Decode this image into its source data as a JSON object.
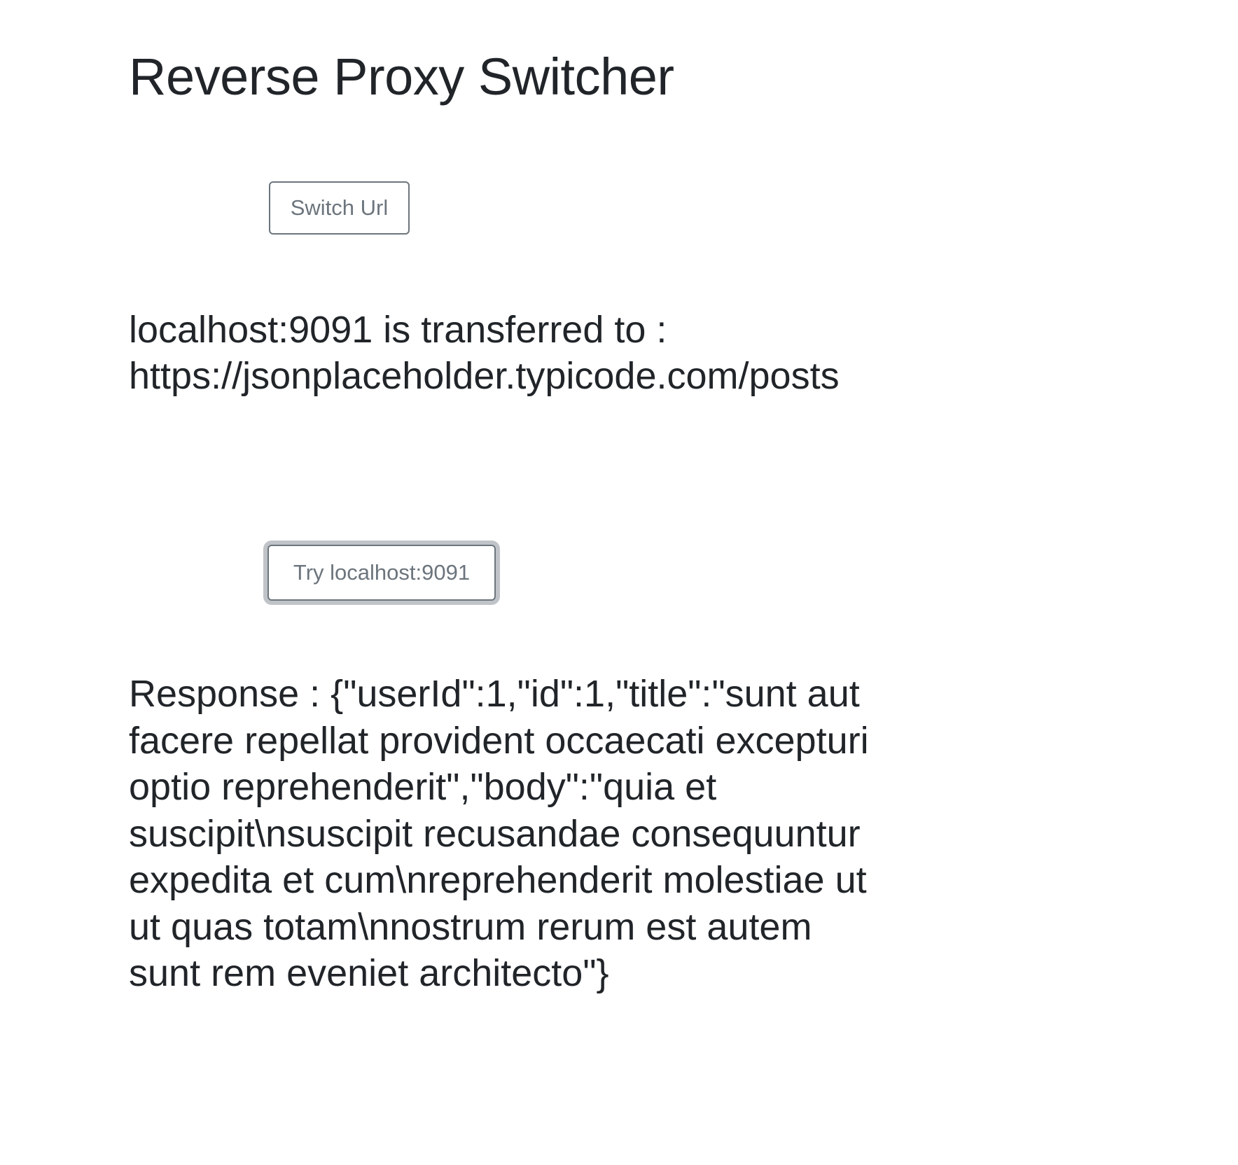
{
  "page": {
    "title": "Reverse Proxy Switcher"
  },
  "switch": {
    "button_label": "Switch Url"
  },
  "transfer": {
    "line1": "localhost:9091 is transferred to :",
    "line2": "https://jsonplaceholder.typicode.com/posts"
  },
  "try": {
    "button_label": "Try localhost:9091"
  },
  "response": {
    "text": "Response : {\"userId\":1,\"id\":1,\"title\":\"sunt aut facere repellat provident occaecati excepturi optio reprehenderit\",\"body\":\"quia et suscipit\\nsuscipit recusandae consequuntur expedita et cum\\nreprehenderit molestiae ut ut quas totam\\nnostrum rerum est autem sunt rem eveniet architecto\"}"
  },
  "colors": {
    "text": "#212529",
    "button_outline": "#6c757d",
    "background": "#ffffff"
  }
}
